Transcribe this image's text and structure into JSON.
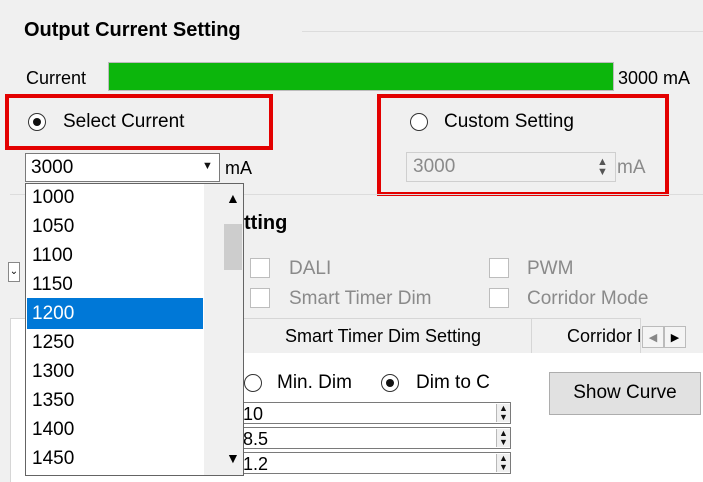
{
  "output_current": {
    "title": "Output Current Setting",
    "current_label": "Current",
    "current_value_text": "3000 mA",
    "bar_fraction": 1.0,
    "bar_color": "#0cb60c"
  },
  "select_current": {
    "label": "Select Current",
    "checked": true,
    "value": "3000",
    "unit": "mA"
  },
  "custom_setting": {
    "label": "Custom Setting",
    "checked": false,
    "value": "3000",
    "unit": "mA"
  },
  "dropdown": {
    "items": [
      "1000",
      "1050",
      "1100",
      "1150",
      "1200",
      "1250",
      "1300",
      "1350",
      "1400",
      "1450"
    ],
    "selected": "1200"
  },
  "dim_section": {
    "title_fragment": "tting",
    "options": [
      "DALI",
      "PWM",
      "Smart Timer Dim",
      "Corridor Mode"
    ]
  },
  "tabs": [
    "Smart Timer Dim Setting",
    "Corridor M"
  ],
  "min_dim_label": "Min. Dim",
  "dim_to_label": "Dim to C",
  "spin_values": [
    "10",
    "8.5",
    "1.2"
  ],
  "show_curve_label": "Show Curve",
  "colors": {
    "highlight": "#e30000",
    "selection": "#0078d7"
  }
}
